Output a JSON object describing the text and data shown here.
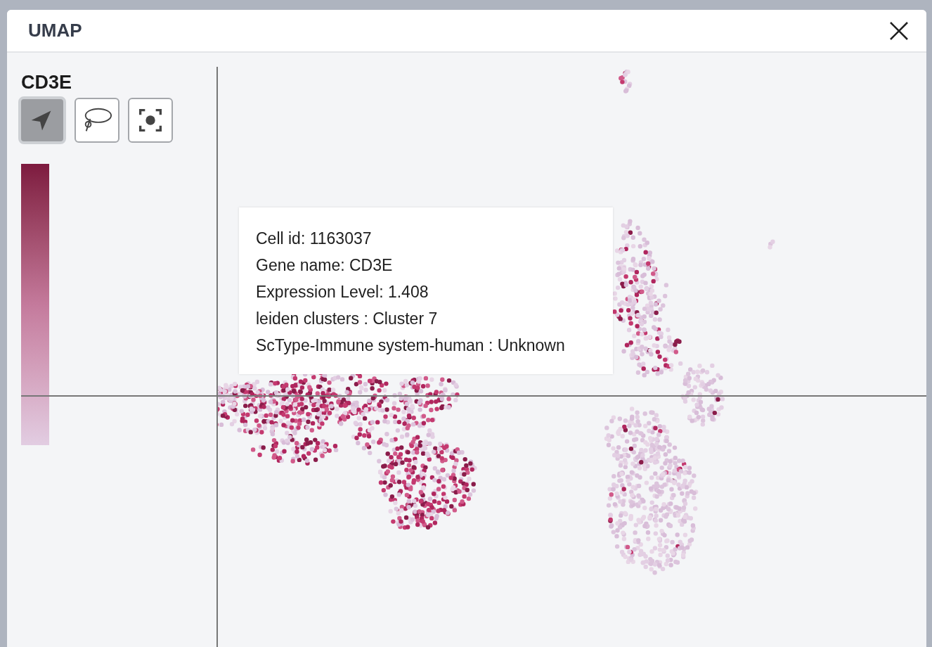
{
  "window": {
    "title": "UMAP"
  },
  "gene": "CD3E",
  "tools": [
    {
      "kind": "pointer",
      "selected": true
    },
    {
      "kind": "lasso",
      "selected": false
    },
    {
      "kind": "focus",
      "selected": false
    }
  ],
  "tooltip": {
    "lines": [
      "Cell id: 1163037",
      "Gene name: CD3E",
      "Expression Level: 1.408",
      "leiden clusters : Cluster 7",
      "ScType-Immune system-human : Unknown"
    ]
  }
}
